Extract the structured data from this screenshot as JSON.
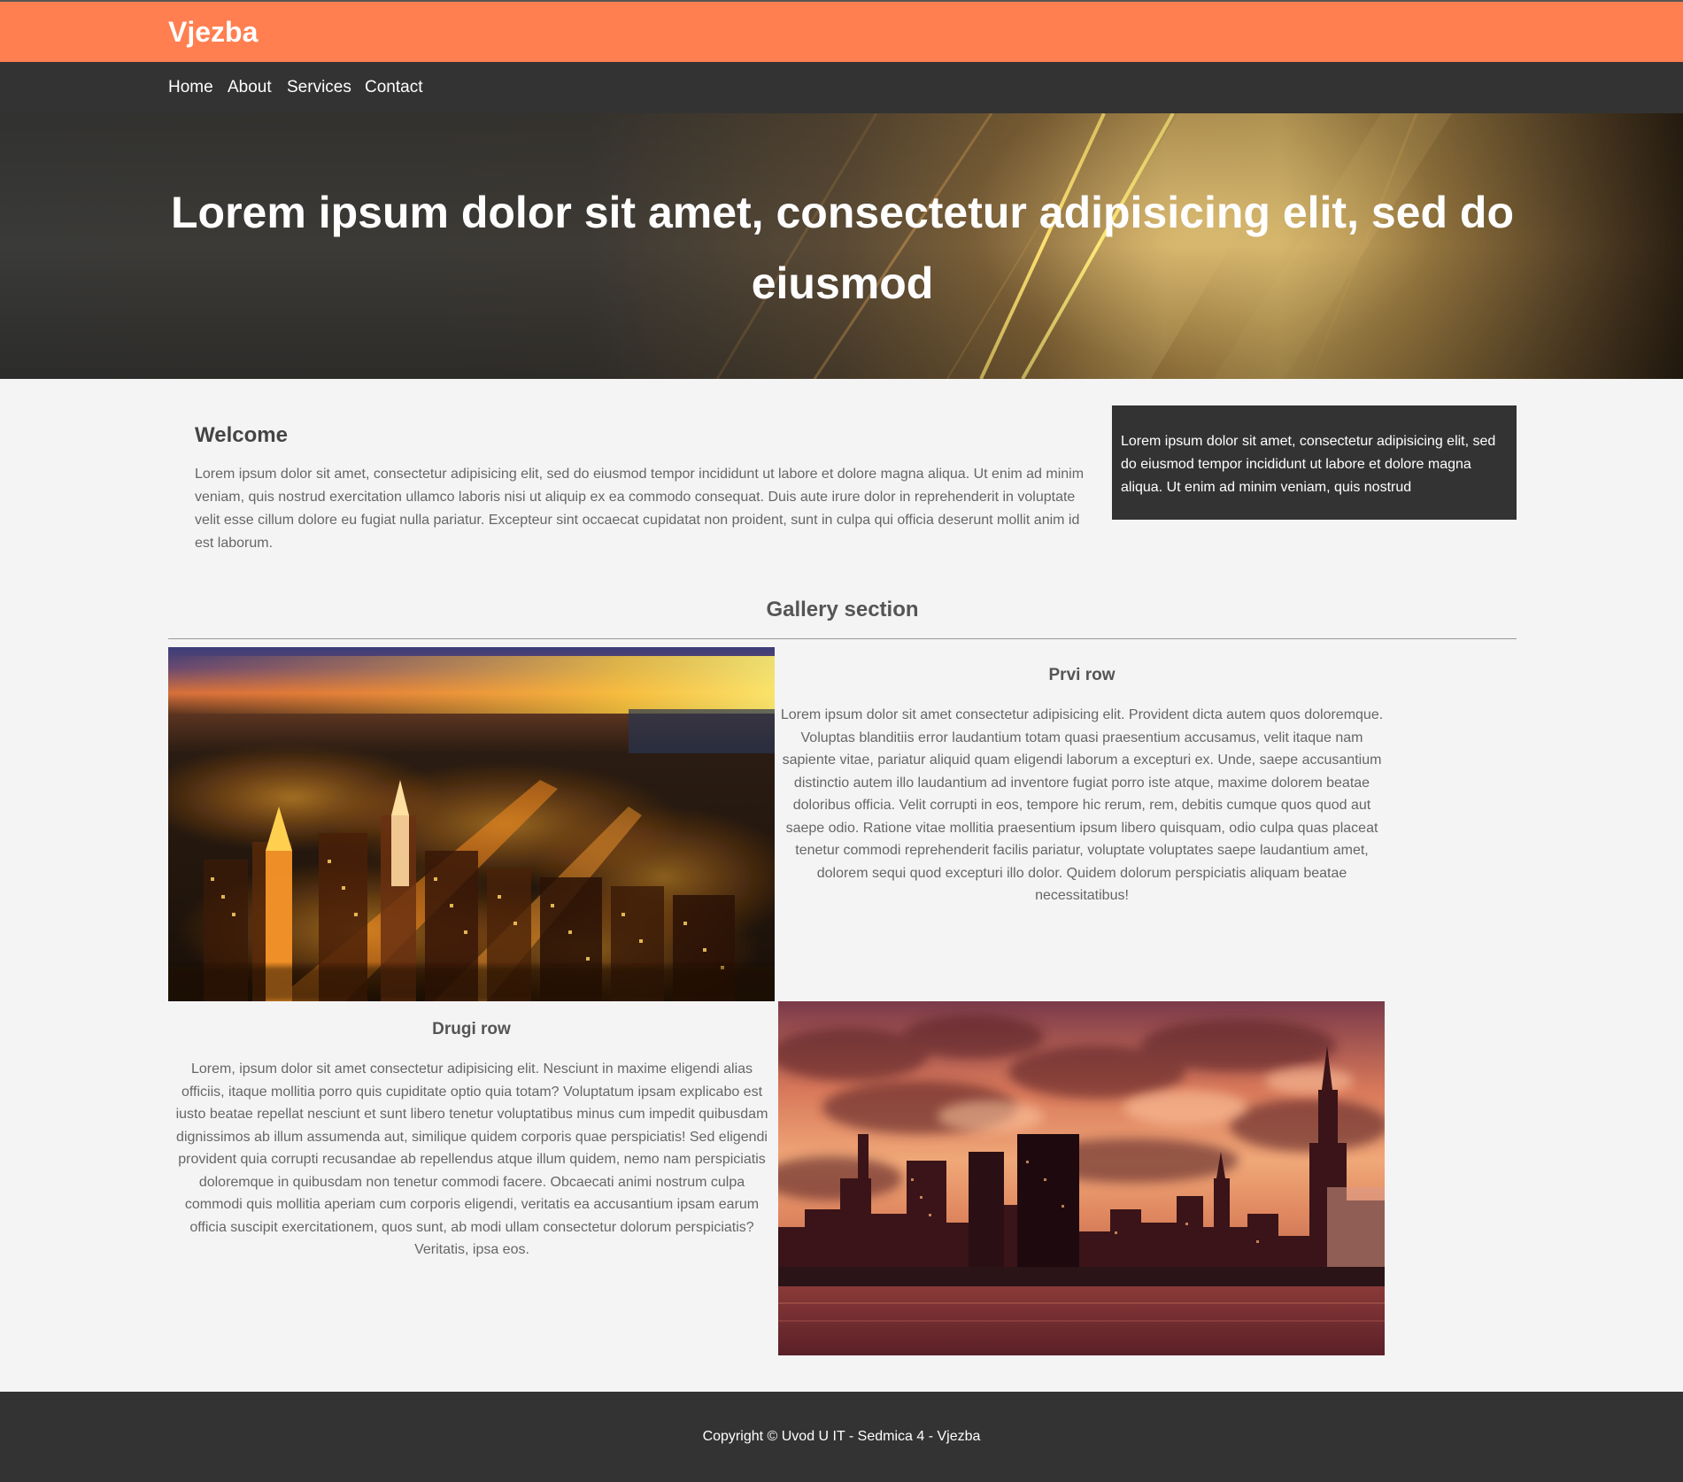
{
  "header": {
    "brand": "Vjezba"
  },
  "nav": {
    "items": [
      "Home",
      "About",
      "Services",
      "Contact"
    ]
  },
  "hero": {
    "title": "Lorem ipsum dolor sit amet, consectetur adipisicing elit, sed do eiusmod"
  },
  "welcome": {
    "title": "Welcome",
    "text": "Lorem ipsum dolor sit amet, consectetur adipisicing elit, sed do eiusmod tempor incididunt ut labore et dolore magna aliqua. Ut enim ad minim veniam, quis nostrud exercitation ullamco laboris nisi ut aliquip ex ea commodo consequat. Duis aute irure dolor in reprehenderit in voluptate velit esse cillum dolore eu fugiat nulla pariatur. Excepteur sint occaecat cupidatat non proident, sunt in culpa qui officia deserunt mollit anim id est laborum."
  },
  "aside": {
    "text": "Lorem ipsum dolor sit amet, consectetur adipisicing elit, sed do eiusmod tempor incididunt ut labore et dolore magna aliqua. Ut enim ad minim veniam, quis nostrud"
  },
  "gallery": {
    "title": "Gallery section",
    "rows": [
      {
        "title": "Prvi row",
        "text": "Lorem ipsum dolor sit amet consectetur adipisicing elit. Provident dicta autem quos doloremque. Voluptas blanditiis error laudantium totam quasi praesentium accusamus, velit itaque nam sapiente vitae, pariatur aliquid quam eligendi laborum a excepturi ex. Unde, saepe accusantium distinctio autem illo laudantium ad inventore fugiat porro iste atque, maxime dolorem beatae doloribus officia. Velit corrupti in eos, tempore hic rerum, rem, debitis cumque quos quod aut saepe odio. Ratione vitae mollitia praesentium ipsum libero quisquam, odio culpa quas placeat tenetur commodi reprehenderit facilis pariatur, voluptate voluptates saepe laudantium amet, dolorem sequi quod excepturi illo dolor. Quidem dolorum perspiciatis aliquam beatae necessitatibus!"
      },
      {
        "title": "Drugi row",
        "text": "Lorem, ipsum dolor sit amet consectetur adipisicing elit. Nesciunt in maxime eligendi alias officiis, itaque mollitia porro quis cupiditate optio quia totam? Voluptatum ipsam explicabo est iusto beatae repellat nesciunt et sunt libero tenetur voluptatibus minus cum impedit quibusdam dignissimos ab illum assumenda aut, similique quidem corporis quae perspiciatis! Sed eligendi provident quia corrupti recusandae ab repellendus atque illum quidem, nemo nam perspiciatis doloremque in quibusdam non tenetur commodi facere. Obcaecati animi nostrum culpa commodi quis mollitia aperiam cum corporis eligendi, veritatis ea accusantium ipsam earum officia suscipit exercitationem, quos sunt, ab modi ullam consectetur dolorum perspiciatis? Veritatis, ipsa eos."
      }
    ]
  },
  "footer": {
    "text": "Copyright © Uvod U IT - Sedmica 4 - Vjezba"
  },
  "colors": {
    "accent": "#ff7f50",
    "dark": "#333333",
    "background": "#f4f4f4"
  }
}
